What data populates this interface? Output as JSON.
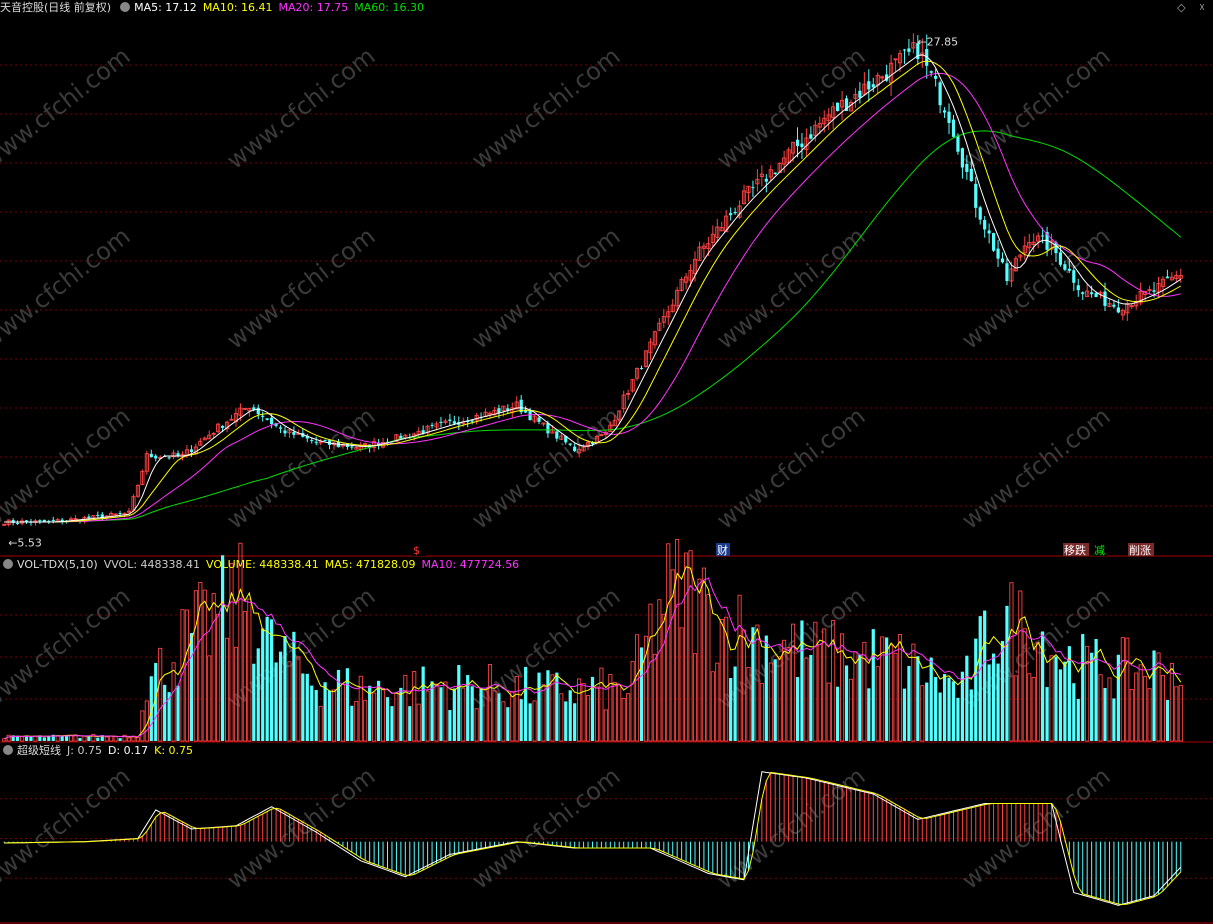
{
  "header": {
    "stock_name": "天音控股(日线 前复权)",
    "ma_labels": [
      {
        "text": "MA5: 17.12",
        "color": "#ffffff"
      },
      {
        "text": "MA10: 16.41",
        "color": "#ffff00"
      },
      {
        "text": "MA20: 17.75",
        "color": "#ff33ff"
      },
      {
        "text": "MA60: 16.30",
        "color": "#00dd00"
      }
    ]
  },
  "volume_header": {
    "title": "VOL-TDX(5,10)",
    "labels": [
      {
        "text": "VVOL: 448338.41",
        "color": "#cccccc"
      },
      {
        "text": "VOLUME: 448338.41",
        "color": "#ffff00"
      },
      {
        "text": "MA5: 471828.09",
        "color": "#ffff00"
      },
      {
        "text": "MA10: 477724.56",
        "color": "#ff33ff"
      }
    ]
  },
  "indicator_header": {
    "title": "超级短线",
    "labels": [
      {
        "text": "J: 0.75",
        "color": "#cccccc"
      },
      {
        "text": "D: 0.17",
        "color": "#ffffff"
      },
      {
        "text": "K: 0.75",
        "color": "#ffff00"
      }
    ]
  },
  "annotations": {
    "high_price": "27.85",
    "low_price": "5.53",
    "markers": [
      {
        "text": "$",
        "color": "#ff3333",
        "bg": "#000000"
      },
      {
        "text": "财",
        "color": "#ffffff",
        "bg": "#1a3a8a"
      },
      {
        "text": "移跌",
        "color": "#ffffff",
        "bg": "#7a2a2a"
      },
      {
        "text": "减",
        "color": "#00ee00",
        "bg": "#000000"
      },
      {
        "text": "削涨",
        "color": "#ffffff",
        "bg": "#7a2a2a"
      }
    ]
  },
  "watermark": "www.cfchi.com",
  "colors": {
    "up": "#ff4444",
    "down": "#54ffff",
    "grid": "#7a0000",
    "frame": "#aa0000",
    "ma5": "#ffffff",
    "ma10": "#ffff00",
    "ma20": "#ff33ff",
    "ma60": "#00dd00"
  },
  "chart_data": {
    "type": "candlestick",
    "price_range": [
      5.53,
      27.85
    ],
    "series": [
      {
        "name": "MA5",
        "last": 17.12
      },
      {
        "name": "MA10",
        "last": 16.41
      },
      {
        "name": "MA20",
        "last": 17.75
      },
      {
        "name": "MA60",
        "last": 16.3
      }
    ],
    "volume": {
      "VOLUME": 448338.41,
      "MA5": 471828.09,
      "MA10": 477724.56
    },
    "kdj": {
      "J": 0.75,
      "D": 0.17,
      "K": 0.75
    },
    "close_keypoints": [
      [
        0,
        6.0
      ],
      [
        10,
        6.0
      ],
      [
        20,
        6.2
      ],
      [
        28,
        6.4
      ],
      [
        32,
        9.0
      ],
      [
        40,
        9.0
      ],
      [
        48,
        10.3
      ],
      [
        55,
        11.3
      ],
      [
        62,
        10.2
      ],
      [
        70,
        9.6
      ],
      [
        80,
        9.4
      ],
      [
        90,
        9.9
      ],
      [
        100,
        10.5
      ],
      [
        110,
        11.0
      ],
      [
        115,
        11.3
      ],
      [
        120,
        10.5
      ],
      [
        128,
        9.3
      ],
      [
        135,
        10.0
      ],
      [
        145,
        14.0
      ],
      [
        155,
        18.0
      ],
      [
        165,
        20.5
      ],
      [
        175,
        22.5
      ],
      [
        185,
        24.5
      ],
      [
        195,
        26.0
      ],
      [
        205,
        27.5
      ],
      [
        212,
        24.5
      ],
      [
        218,
        20.5
      ],
      [
        225,
        17.0
      ],
      [
        230,
        19.0
      ],
      [
        235,
        18.5
      ],
      [
        242,
        16.5
      ],
      [
        250,
        15.8
      ],
      [
        258,
        16.5
      ],
      [
        264,
        17.3
      ]
    ],
    "volume_keypoints": [
      [
        0,
        8
      ],
      [
        30,
        10
      ],
      [
        31,
        100
      ],
      [
        40,
        190
      ],
      [
        50,
        260
      ],
      [
        55,
        280
      ],
      [
        60,
        180
      ],
      [
        70,
        120
      ],
      [
        80,
        100
      ],
      [
        100,
        110
      ],
      [
        120,
        100
      ],
      [
        140,
        100
      ],
      [
        148,
        280
      ],
      [
        153,
        300
      ],
      [
        160,
        230
      ],
      [
        170,
        200
      ],
      [
        180,
        170
      ],
      [
        200,
        160
      ],
      [
        215,
        100
      ],
      [
        222,
        230
      ],
      [
        230,
        220
      ],
      [
        240,
        150
      ],
      [
        250,
        140
      ],
      [
        264,
        140
      ]
    ],
    "j_keypoints": [
      [
        0,
        38
      ],
      [
        18,
        40
      ],
      [
        30,
        45
      ],
      [
        34,
        90
      ],
      [
        42,
        60
      ],
      [
        52,
        65
      ],
      [
        60,
        95
      ],
      [
        70,
        55
      ],
      [
        80,
        10
      ],
      [
        90,
        -15
      ],
      [
        100,
        20
      ],
      [
        115,
        40
      ],
      [
        128,
        30
      ],
      [
        145,
        30
      ],
      [
        158,
        -10
      ],
      [
        166,
        -20
      ],
      [
        170,
        150
      ],
      [
        180,
        140
      ],
      [
        195,
        115
      ],
      [
        205,
        75
      ],
      [
        220,
        100
      ],
      [
        235,
        100
      ],
      [
        240,
        -40
      ],
      [
        250,
        -60
      ],
      [
        258,
        -45
      ],
      [
        264,
        0
      ]
    ]
  }
}
